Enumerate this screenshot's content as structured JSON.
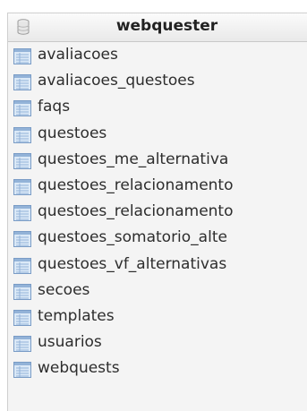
{
  "panel": {
    "title": "webquester",
    "icon": "database-icon"
  },
  "tables": [
    {
      "label": "avaliacoes",
      "icon": "table-icon"
    },
    {
      "label": "avaliacoes_questoes",
      "icon": "table-icon"
    },
    {
      "label": "faqs",
      "icon": "table-icon"
    },
    {
      "label": "questoes",
      "icon": "table-icon"
    },
    {
      "label": "questoes_me_alternativa",
      "icon": "table-icon"
    },
    {
      "label": "questoes_relacionamento",
      "icon": "table-icon"
    },
    {
      "label": "questoes_relacionamento",
      "icon": "table-icon"
    },
    {
      "label": "questoes_somatorio_alte",
      "icon": "table-icon"
    },
    {
      "label": "questoes_vf_alternativas",
      "icon": "table-icon"
    },
    {
      "label": "secoes",
      "icon": "table-icon"
    },
    {
      "label": "templates",
      "icon": "table-icon"
    },
    {
      "label": "usuarios",
      "icon": "table-icon"
    },
    {
      "label": "webquests",
      "icon": "table-icon"
    }
  ],
  "colors": {
    "icon_fill": "#dbe9f7",
    "icon_border": "#7a9cc6",
    "icon_lines": "#93b3d8"
  }
}
